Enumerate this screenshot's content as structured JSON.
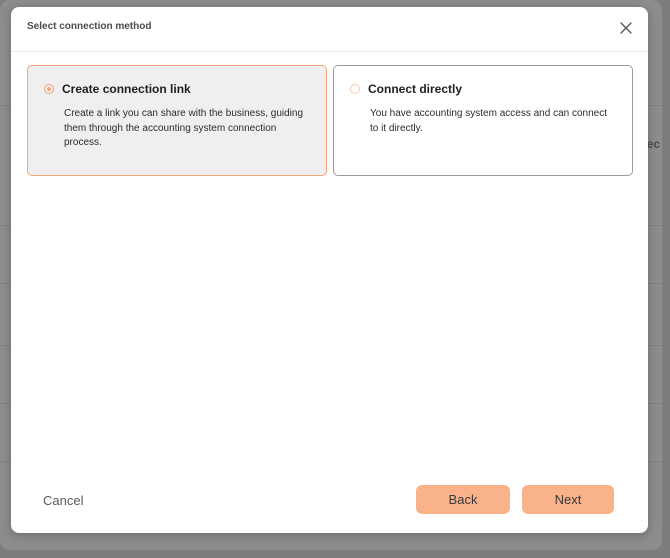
{
  "background": {
    "partial_text": "ec"
  },
  "modal": {
    "title": "Select connection method",
    "close_icon": "close-icon",
    "options": [
      {
        "title": "Create connection link",
        "description": "Create a link you can share with the business, guiding them through the accounting system connection process.",
        "selected": true
      },
      {
        "title": "Connect directly",
        "description": "You have accounting system access and can connect to it directly.",
        "selected": false
      }
    ]
  },
  "footer": {
    "cancel_label": "Cancel",
    "back_label": "Back",
    "next_label": "Next"
  },
  "colors": {
    "accent": "#f9b28a",
    "selected_border": "#f5a577",
    "selected_bg": "#efefef"
  }
}
